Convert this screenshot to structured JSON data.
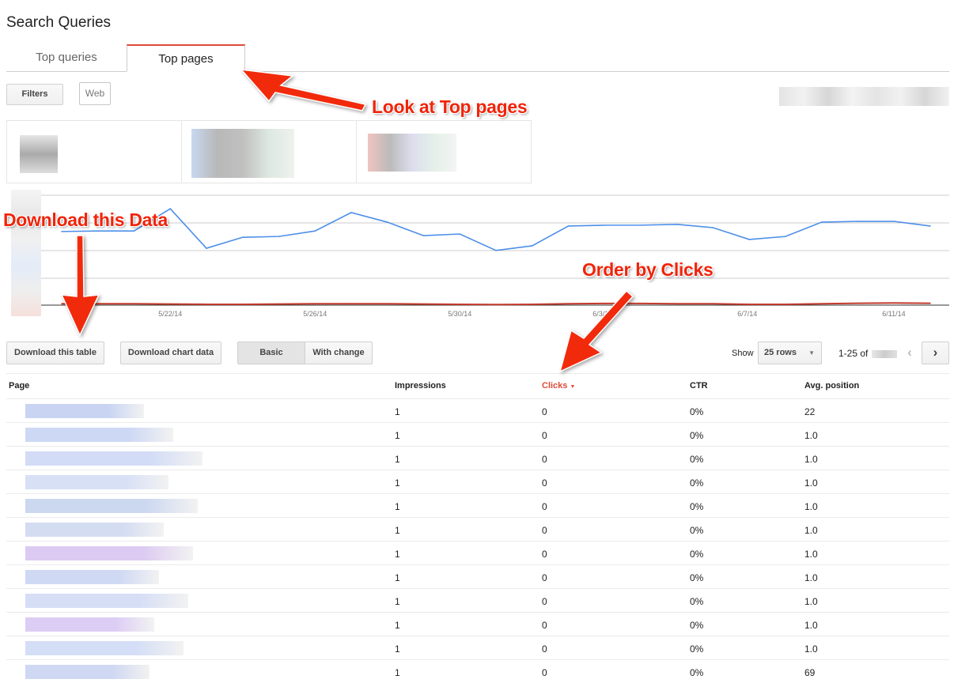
{
  "page_title": "Search Queries",
  "tabs": [
    {
      "label": "Top queries",
      "active": false
    },
    {
      "label": "Top pages",
      "active": true
    }
  ],
  "filters_button": "Filters",
  "web_pill": "Web",
  "chart_data": {
    "type": "line",
    "x": [
      "5/19/14",
      "5/20/14",
      "5/21/14",
      "5/22/14",
      "5/23/14",
      "5/24/14",
      "5/25/14",
      "5/26/14",
      "5/27/14",
      "5/28/14",
      "5/29/14",
      "5/30/14",
      "5/31/14",
      "6/1/14",
      "6/2/14",
      "6/3/14",
      "6/4/14",
      "6/5/14",
      "6/6/14",
      "6/7/14",
      "6/8/14",
      "6/9/14",
      "6/10/14",
      "6/11/14",
      "6/12/14"
    ],
    "tick_labels": [
      "5/22/14",
      "5/26/14",
      "5/30/14",
      "6/3/14",
      "6/7/14",
      "6/11/14"
    ],
    "series": [
      {
        "color": "#4d8fe8",
        "values": [
          2.68,
          2.7,
          2.7,
          3.51,
          2.07,
          2.47,
          2.5,
          2.7,
          3.37,
          3.02,
          2.53,
          2.59,
          1.99,
          2.16,
          2.88,
          2.91,
          2.91,
          2.94,
          2.82,
          2.39,
          2.5,
          3.02,
          3.05,
          3.05,
          2.88
        ]
      },
      {
        "color": "#c33a2c",
        "values": [
          0.05,
          0.05,
          0.05,
          0.04,
          0.03,
          0.03,
          0.04,
          0.05,
          0.05,
          0.05,
          0.04,
          0.03,
          0.02,
          0.03,
          0.05,
          0.06,
          0.06,
          0.05,
          0.05,
          0.03,
          0.03,
          0.05,
          0.07,
          0.08,
          0.07
        ]
      }
    ],
    "ylim": [
      0,
      4
    ],
    "grid": true
  },
  "toolbar": {
    "download_table": "Download this table",
    "download_chart": "Download chart data",
    "basic": "Basic",
    "with_change": "With change",
    "show_label": "Show",
    "rows_select": "25 rows",
    "range": "1-25 of"
  },
  "table": {
    "headers": [
      "Page",
      "Impressions",
      "Clicks",
      "CTR",
      "Avg. position"
    ],
    "sort_column": "Clicks",
    "rows": [
      [
        "1",
        "0",
        "0%",
        "22"
      ],
      [
        "1",
        "0",
        "0%",
        "1.0"
      ],
      [
        "1",
        "0",
        "0%",
        "1.0"
      ],
      [
        "1",
        "0",
        "0%",
        "1.0"
      ],
      [
        "1",
        "0",
        "0%",
        "1.0"
      ],
      [
        "1",
        "0",
        "0%",
        "1.0"
      ],
      [
        "1",
        "0",
        "0%",
        "1.0"
      ],
      [
        "1",
        "0",
        "0%",
        "1.0"
      ],
      [
        "1",
        "0",
        "0%",
        "1.0"
      ],
      [
        "1",
        "0",
        "0%",
        "1.0"
      ],
      [
        "1",
        "0",
        "0%",
        "1.0"
      ],
      [
        "1",
        "0",
        "0%",
        "69"
      ]
    ]
  },
  "annotations": {
    "top_pages": "Look at Top pages",
    "download": "Download this Data",
    "order": "Order by Clicks"
  },
  "colors": {
    "accent": "#dd4b39",
    "annotation": "#f0240a"
  }
}
